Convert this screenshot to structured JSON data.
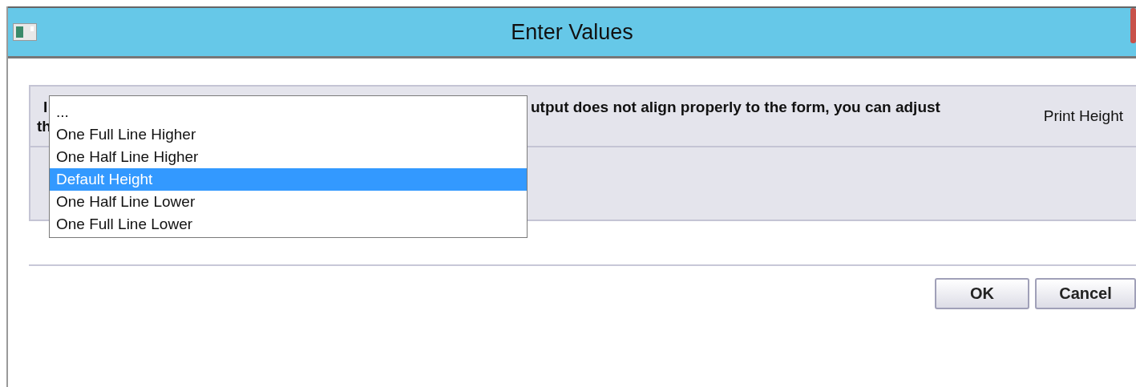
{
  "window": {
    "title": "Enter Values"
  },
  "panel": {
    "instruction": {
      "line_1_start": "I",
      "line_1_end": "utput does not align properly to the form, you can adjust",
      "line_2_start": "th"
    },
    "field_label": "Print Height"
  },
  "dropdown": {
    "options": [
      {
        "label": "...",
        "selected": false
      },
      {
        "label": "One Full Line Higher",
        "selected": false
      },
      {
        "label": "One Half Line Higher",
        "selected": false
      },
      {
        "label": "Default Height",
        "selected": true
      },
      {
        "label": "One Half Line Lower",
        "selected": false
      },
      {
        "label": "One Full Line Lower",
        "selected": false
      }
    ]
  },
  "buttons": [
    {
      "label": "OK"
    },
    {
      "label": "Cancel"
    }
  ]
}
